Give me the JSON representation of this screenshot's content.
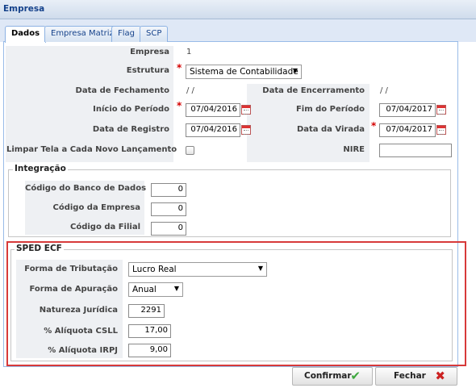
{
  "window": {
    "title": "Empresa"
  },
  "tabs": [
    {
      "label": "Dados",
      "active": true
    },
    {
      "label": "Empresa Matriz",
      "active": false
    },
    {
      "label": "Flag",
      "active": false
    },
    {
      "label": "SCP",
      "active": false
    }
  ],
  "dados": {
    "empresa_label": "Empresa",
    "empresa_value": "1",
    "estrutura_label": "Estrutura",
    "estrutura_value": "Sistema de Contabilidade",
    "data_fechamento_label": "Data de Fechamento",
    "data_fechamento_value": "/ /",
    "data_encerramento_label": "Data de Encerramento",
    "data_encerramento_value": "/ /",
    "inicio_periodo_label": "Início do Período",
    "inicio_periodo_value": "07/04/2016",
    "fim_periodo_label": "Fim do Período",
    "fim_periodo_value": "07/04/2017",
    "data_registro_label": "Data de Registro",
    "data_registro_value": "07/04/2016",
    "data_virada_label": "Data da Virada",
    "data_virada_value": "07/04/2017",
    "limpar_tela_label": "Limpar Tela a Cada Novo Lançamento",
    "nire_label": "NIRE",
    "nire_value": ""
  },
  "integracao": {
    "legend": "Integração",
    "codigo_banco_label": "Código do Banco de Dados",
    "codigo_banco_value": "0",
    "codigo_empresa_label": "Código da Empresa",
    "codigo_empresa_value": "0",
    "codigo_filial_label": "Código da Filial",
    "codigo_filial_value": "0"
  },
  "sped": {
    "legend": "SPED ECF",
    "forma_tributacao_label": "Forma de Tributação",
    "forma_tributacao_value": "Lucro Real",
    "forma_apuracao_label": "Forma de Apuração",
    "forma_apuracao_value": "Anual",
    "natureza_label": "Natureza Jurídica",
    "natureza_value": "2291",
    "csll_label": "% Alíquota CSLL",
    "csll_value": "17,00",
    "irpj_label": "% Alíquota IRPJ",
    "irpj_value": "9,00"
  },
  "buttons": {
    "confirmar": "Confirmar",
    "fechar": "Fechar"
  },
  "icons": {
    "dropdown": "triangle-down-icon",
    "calendar": "calendar-icon",
    "confirm": "check-icon",
    "close": "close-x-icon"
  },
  "colors": {
    "highlight_border": "#d73a3a",
    "required": "#d40000",
    "title": "#15428b"
  }
}
